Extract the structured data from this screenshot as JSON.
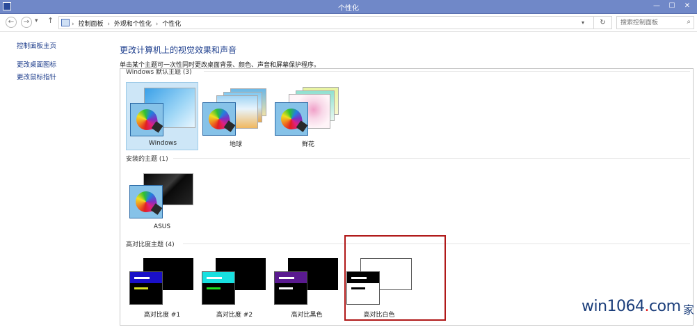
{
  "window": {
    "title": "个性化",
    "minimize": "—",
    "maximize": "☐",
    "close": "✕"
  },
  "address": {
    "back": "←",
    "forward": "→",
    "dropdown": "▾",
    "up": "↑",
    "crumbs": [
      "控制面板",
      "外观和个性化",
      "个性化"
    ],
    "separator": "›",
    "addr_dropdown": "▾",
    "refresh": "↻"
  },
  "search": {
    "placeholder": "搜索控制面板",
    "icon": "search-icon"
  },
  "sidebar": {
    "items": [
      {
        "label": "控制面板主页"
      },
      {
        "label": "更改桌面图标"
      },
      {
        "label": "更改鼠标指针"
      }
    ]
  },
  "main": {
    "title": "更改计算机上的视觉效果和声音",
    "description": "单击某个主题可一次性同时更改桌面背景、颜色、声音和屏幕保护程序。"
  },
  "groups": [
    {
      "label": "Windows 默认主题 (3)",
      "themes": [
        {
          "label": "Windows",
          "selected": true
        },
        {
          "label": "地球"
        },
        {
          "label": "鲜花"
        }
      ]
    },
    {
      "label": "安装的主题 (1)",
      "themes": [
        {
          "label": "ASUS"
        }
      ]
    },
    {
      "label": "高对比度主题 (4)",
      "themes": [
        {
          "label": "高对比度 #1"
        },
        {
          "label": "高对比度 #2"
        },
        {
          "label": "高对比黑色"
        },
        {
          "label": "高对比白色",
          "highlighted": true
        }
      ]
    }
  ],
  "watermark": {
    "text1": "win1064",
    "dot": ".",
    "text2": "com",
    "extra": "家"
  },
  "colors": {
    "titlebar": "#7088c8",
    "selection": "#cde6f7",
    "highlight_box": "#b01818",
    "link": "#1a3a8a"
  }
}
